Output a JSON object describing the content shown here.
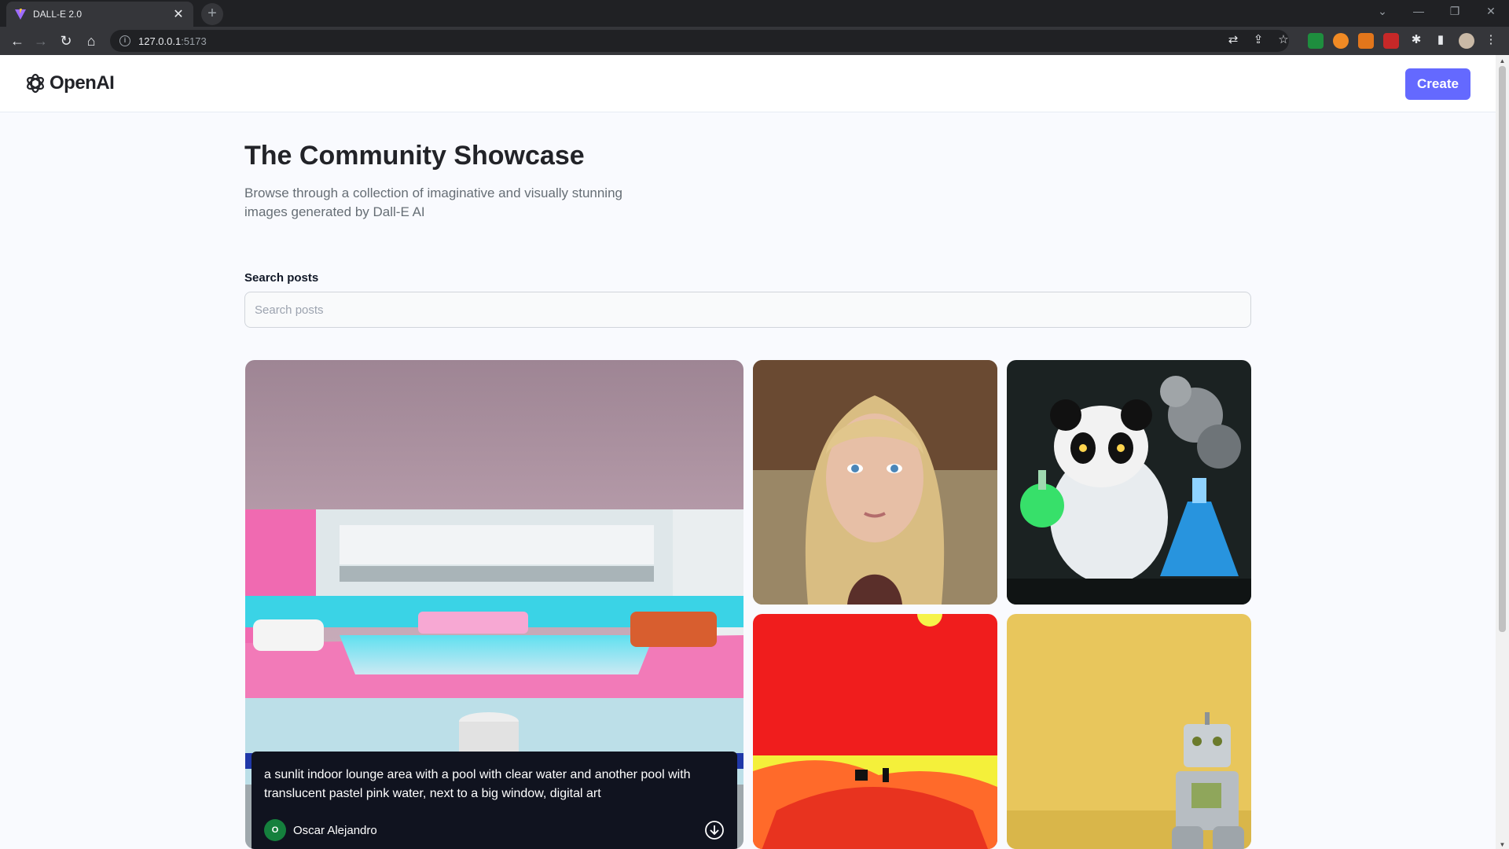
{
  "browser": {
    "tab_title": "DALL-E 2.0",
    "tab_close": "✕",
    "new_tab": "+",
    "url_host": "127.0.0.1",
    "url_port": ":5173"
  },
  "header": {
    "logo_text": "OpenAI",
    "create_label": "Create"
  },
  "hero": {
    "title": "The Community Showcase",
    "subtitle": "Browse through a collection of imaginative and visually stunning images generated by Dall-E AI"
  },
  "search": {
    "label": "Search posts",
    "placeholder": "Search posts",
    "value": ""
  },
  "posts": [
    {
      "prompt": "a sunlit indoor lounge area with a pool with clear water and another pool with translucent pastel pink water, next to a big window, digital art",
      "author": "Oscar Alejandro",
      "avatar_initial": "O"
    }
  ],
  "colors": {
    "accent": "#6469ff",
    "page_bg": "#f9fafe",
    "overlay_bg": "#10131f",
    "avatar_bg": "#15803d"
  }
}
